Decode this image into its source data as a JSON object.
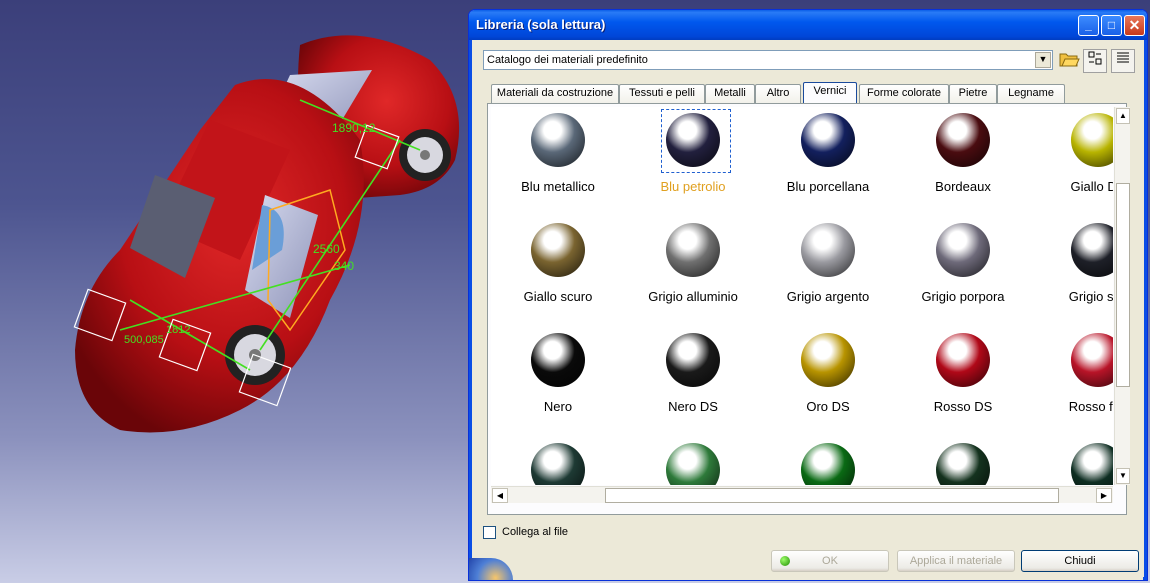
{
  "viewport": {
    "dimension_labels": [
      "1890,12",
      "2560",
      "340",
      "1812",
      "500,085"
    ]
  },
  "dialog": {
    "title": "Libreria (sola lettura)",
    "window_buttons": {
      "minimize": "_",
      "maximize": "□",
      "close": "✕"
    },
    "catalog_select": {
      "value": "Catalogo dei materiali predefinito",
      "arrow": "▼"
    },
    "toolbar": {
      "open_icon": "folder-open-icon",
      "view_icons_icon": "icon-view-icon",
      "view_list_icon": "list-view-icon"
    },
    "tabs": [
      {
        "label": "Materiali da costruzione"
      },
      {
        "label": "Tessuti e pelli"
      },
      {
        "label": "Metalli"
      },
      {
        "label": "Altro"
      },
      {
        "label": "Vernici",
        "active": true
      },
      {
        "label": "Forme colorate"
      },
      {
        "label": "Pietre"
      },
      {
        "label": "Legname"
      }
    ],
    "materials": [
      {
        "label": "Blu metallico",
        "color": "#5a6878"
      },
      {
        "label": "Blu petrolio",
        "color": "#22203e",
        "selected": true
      },
      {
        "label": "Blu porcellana",
        "color": "#13205e"
      },
      {
        "label": "Bordeaux",
        "color": "#4a0c10"
      },
      {
        "label": "Giallo DS",
        "color": "#b8b400"
      },
      {
        "label": "Giallo scuro",
        "color": "#7a6430"
      },
      {
        "label": "Grigio alluminio",
        "color": "#707070"
      },
      {
        "label": "Grigio argento",
        "color": "#9a9aa0"
      },
      {
        "label": "Grigio porpora",
        "color": "#6e6a7a"
      },
      {
        "label": "Grigio scu",
        "color": "#1e2028"
      },
      {
        "label": "Nero",
        "color": "#0a0a0a"
      },
      {
        "label": "Nero DS",
        "color": "#1a1a1a"
      },
      {
        "label": "Oro DS",
        "color": "#b89400"
      },
      {
        "label": "Rosso DS",
        "color": "#b00818"
      },
      {
        "label": "Rosso fuo",
        "color": "#b81428"
      },
      {
        "label": "",
        "color": "#1e3a34"
      },
      {
        "label": "",
        "color": "#2e7a3a"
      },
      {
        "label": "",
        "color": "#0a6a14"
      },
      {
        "label": "",
        "color": "#14321e"
      },
      {
        "label": "",
        "color": "#0e2e22"
      }
    ],
    "link_to_file": {
      "label": "Collega al file",
      "checked": false
    },
    "buttons": {
      "ok": "OK",
      "apply": "Applica il materiale",
      "close": "Chiudi"
    }
  }
}
